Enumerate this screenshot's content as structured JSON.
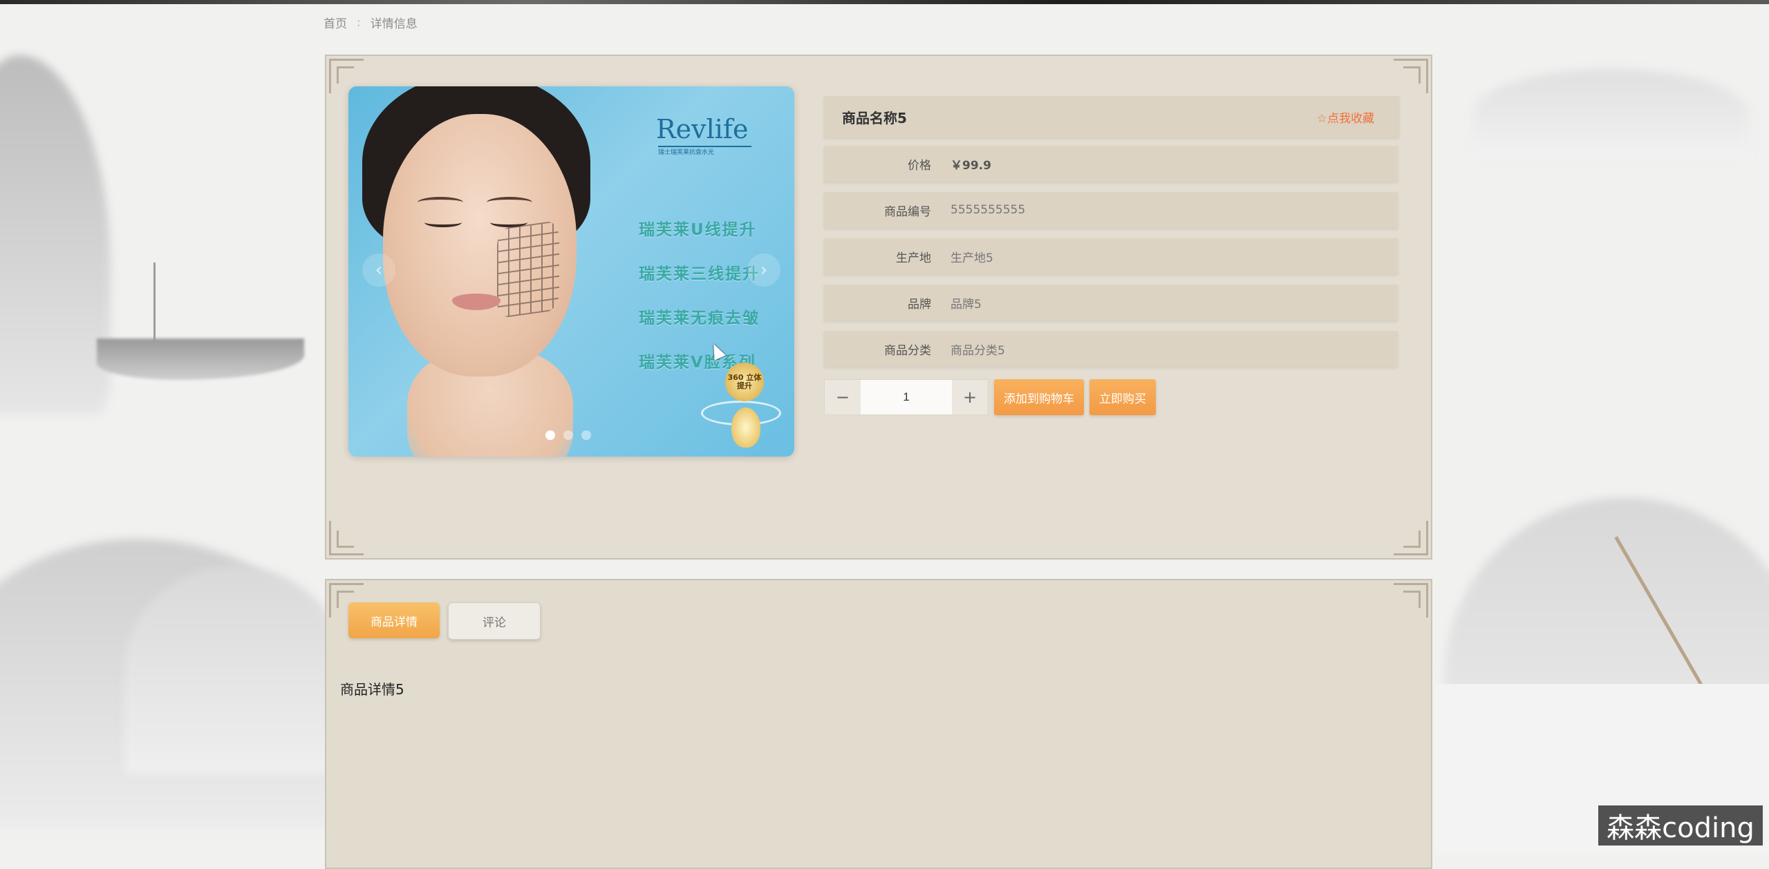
{
  "breadcrumb": {
    "home": "首页",
    "separator": ":",
    "current": "详情信息"
  },
  "product": {
    "name": "商品名称5",
    "favorite_label": "☆点我收藏",
    "fields": [
      {
        "label": "价格",
        "value": "￥99.9"
      },
      {
        "label": "商品编号",
        "value": "5555555555"
      },
      {
        "label": "生产地",
        "value": "生产地5"
      },
      {
        "label": "品牌",
        "value": "品牌5"
      },
      {
        "label": "商品分类",
        "value": "商品分类5"
      }
    ],
    "quantity": "1",
    "minus_icon": "−",
    "plus_icon": "+",
    "add_to_cart_label": "添加到购物车",
    "buy_now_label": "立即购买"
  },
  "carousel": {
    "brand": "Revlife",
    "brand_sub": "瑞士瑞芙莱抗衰水光",
    "slogans": [
      "瑞芙莱U线提升",
      "瑞芙莱三线提升",
      "瑞芙莱无痕去皱",
      "瑞芙莱V脸系列"
    ],
    "badge": "360 立体提升",
    "prev_icon": "‹",
    "next_icon": "›",
    "slide_count": 3,
    "active_slide": 1
  },
  "tabs": [
    {
      "label": "商品详情",
      "active": true
    },
    {
      "label": "评论",
      "active": false
    }
  ],
  "detail_content": "商品详情5",
  "watermark": "森森coding",
  "colors": {
    "accent": "#f39a45",
    "favorite": "#f0713a",
    "panel": "#e4ddd1"
  }
}
